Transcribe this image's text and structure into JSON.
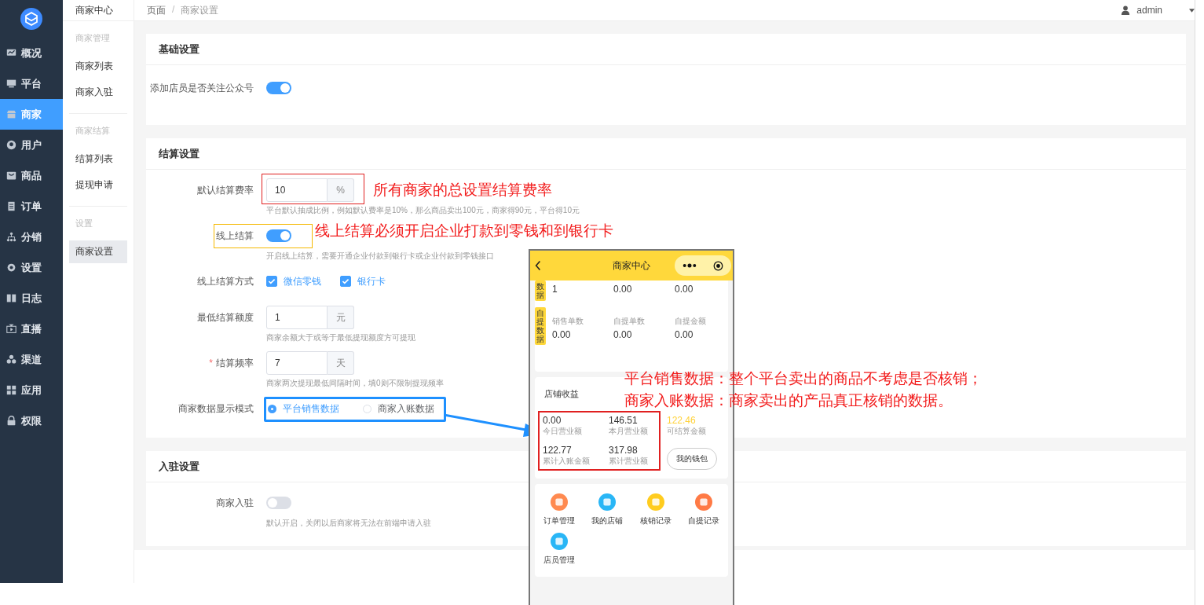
{
  "sidebar": {
    "items": [
      {
        "label": "概况",
        "selected": false
      },
      {
        "label": "平台",
        "selected": false
      },
      {
        "label": "商家",
        "selected": true
      },
      {
        "label": "用户",
        "selected": false
      },
      {
        "label": "商品",
        "selected": false
      },
      {
        "label": "订单",
        "selected": false
      },
      {
        "label": "分销",
        "selected": false
      },
      {
        "label": "设置",
        "selected": false
      },
      {
        "label": "日志",
        "selected": false
      },
      {
        "label": "直播",
        "selected": false
      },
      {
        "label": "渠道",
        "selected": false
      },
      {
        "label": "应用",
        "selected": false
      },
      {
        "label": "权限",
        "selected": false
      }
    ]
  },
  "submenu": {
    "title": "商家中心",
    "groups": [
      {
        "heading": "商家管理",
        "items": [
          {
            "label": "商家列表",
            "selected": false
          },
          {
            "label": "商家入驻",
            "selected": false
          }
        ]
      },
      {
        "heading": "商家结算",
        "items": [
          {
            "label": "结算列表",
            "selected": false
          },
          {
            "label": "提现申请",
            "selected": false
          }
        ]
      },
      {
        "heading": "设置",
        "items": [
          {
            "label": "商家设置",
            "selected": true
          }
        ]
      }
    ]
  },
  "breadcrumb": {
    "items": [
      "页面",
      "商家设置"
    ],
    "separator": "/"
  },
  "user": {
    "name": "admin"
  },
  "sections": [
    {
      "title": "基础设置",
      "fields": [
        {
          "kind": "switch",
          "label": "添加店员是否关注公众号",
          "on": true
        }
      ]
    },
    {
      "title": "结算设置",
      "fields": [
        {
          "kind": "input",
          "label": "默认结算费率",
          "value": "10",
          "unit": "%",
          "hint": "平台默认抽成比例，例如默认费率是10%，那么商品卖出100元，商家得90元，平台得10元",
          "annotation": {
            "color": "#e02020",
            "note": "所有商家的总设置结算费率"
          }
        },
        {
          "kind": "switch",
          "label": "线上结算",
          "on": true,
          "hint": "开启线上结算，需要开通企业付款到银行卡或企业付款到零钱接口",
          "annotation": {
            "color": "#f5b800",
            "note": "线上结算必须开启企业打款到零钱和到银行卡"
          }
        },
        {
          "kind": "checkboxes",
          "label": "线上结算方式",
          "options": [
            {
              "label": "微信零钱",
              "checked": true
            },
            {
              "label": "银行卡",
              "checked": true
            }
          ]
        },
        {
          "kind": "input",
          "label": "最低结算额度",
          "value": "1",
          "unit": "元",
          "hint": "商家余额大于或等于最低提现额度方可提现"
        },
        {
          "kind": "input",
          "label": "结算频率",
          "required": true,
          "required_mark": "*",
          "value": "7",
          "unit": "天",
          "hint": "商家两次提现最低间隔时间，填0则不限制提现频率"
        },
        {
          "kind": "radios",
          "label": "商家数据显示模式",
          "options": [
            {
              "label": "平台销售数据",
              "selected": true
            },
            {
              "label": "商家入账数据",
              "selected": false
            }
          ],
          "annotation": {
            "color": "#1e90ff"
          }
        }
      ]
    },
    {
      "title": "入驻设置",
      "fields": [
        {
          "kind": "switch",
          "label": "商家入驻",
          "on": false,
          "hint": "默认开启，关闭以后商家将无法在前端申请入驻"
        }
      ]
    }
  ],
  "phone": {
    "title": "商家中心",
    "data_blocks": [
      {
        "tag": "数据",
        "values": [
          "1",
          "0.00",
          "0.00"
        ]
      },
      {
        "tag": "自提数据",
        "labels": [
          "销售单数",
          "自提单数",
          "自提金额"
        ],
        "values": [
          "0.00",
          "0.00",
          "0.00"
        ]
      }
    ],
    "earnings": {
      "title": "店铺收益",
      "annotation": {
        "color": "#e02020"
      },
      "stats": [
        {
          "value": "0.00",
          "label": "今日营业额"
        },
        {
          "value": "146.51",
          "label": "本月营业额"
        },
        {
          "value": "122.77",
          "label": "累计入账金额"
        },
        {
          "value": "317.98",
          "label": "累计营业额"
        }
      ],
      "available": {
        "value": "122.46",
        "label": "可结算金额"
      },
      "wallet_button": "我的钱包"
    },
    "menu": [
      {
        "label": "订单管理",
        "color": "#ff8a50"
      },
      {
        "label": "我的店铺",
        "color": "#29b6f6"
      },
      {
        "label": "核销记录",
        "color": "#ffcc1f"
      },
      {
        "label": "自提记录",
        "color": "#ff7a45"
      },
      {
        "label": "店员管理",
        "color": "#29b6f6"
      }
    ]
  },
  "phone_notes": [
    "平台销售数据：整个平台卖出的商品不考虑是否核销；",
    "商家入账数据：商家卖出的产品真正核销的数据。"
  ]
}
